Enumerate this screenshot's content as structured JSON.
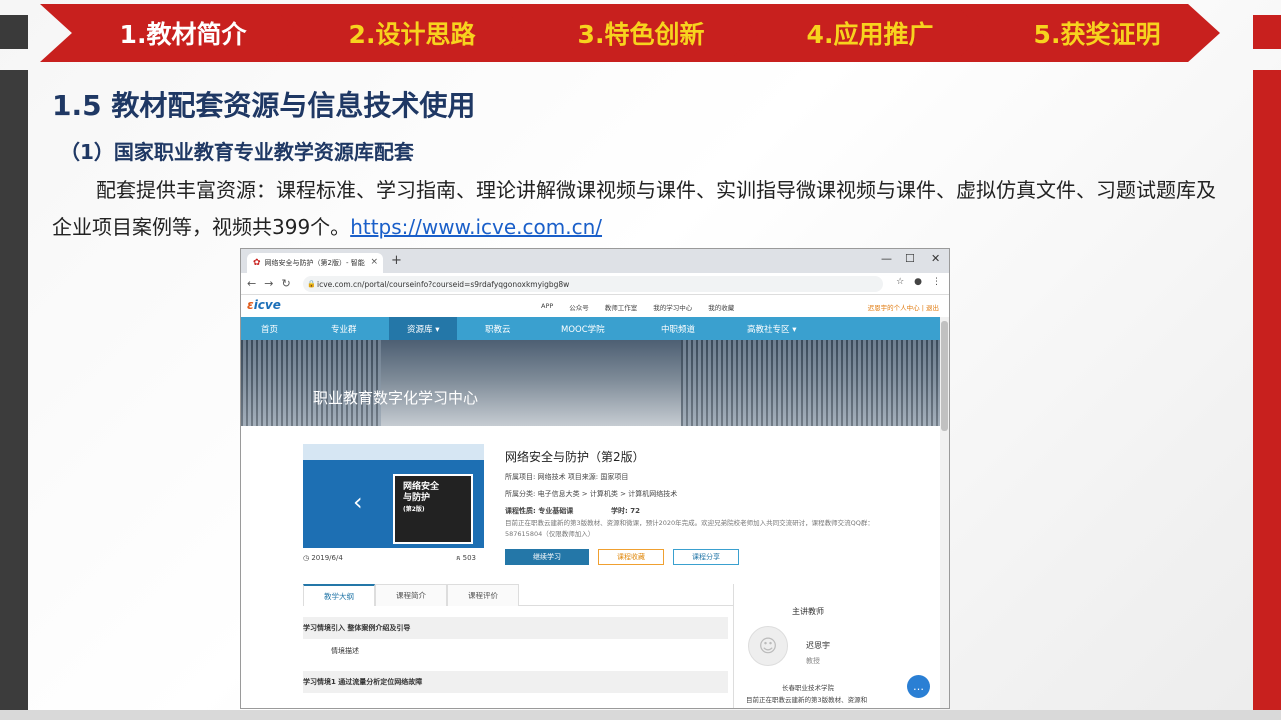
{
  "nav": {
    "items": [
      {
        "label": "1.教材简介",
        "active": true
      },
      {
        "label": "2.设计思路",
        "active": false
      },
      {
        "label": "3.特色创新",
        "active": false
      },
      {
        "label": "4.应用推广",
        "active": false
      },
      {
        "label": "5.获奖证明",
        "active": false
      }
    ]
  },
  "slide": {
    "title": "1.5 教材配套资源与信息技术使用",
    "subtitle": "（1）国家职业教育专业教学资源库配套",
    "body": "配套提供丰富资源：课程标准、学习指南、理论讲解微课视频与课件、实训指导微课视频与课件、虚拟仿真文件、习题试题库及企业项目案例等，视频共399个。",
    "link": "https://www.icve.com.cn/"
  },
  "browser": {
    "tab_title": "网络安全与防护（第2版）- 智能",
    "url": "icve.com.cn/portal/courseinfo?courseid=s9rdafyqgonoxkmyigbg8w",
    "site": {
      "logo": "icve",
      "top_links": [
        "APP",
        "公众号",
        "教师工作室",
        "我的学习中心",
        "我的收藏"
      ],
      "user_links": "迟恩宇的个人中心  |  退出",
      "nav": [
        "首页",
        "专业群",
        "资源库 ▾",
        "职教云",
        "MOOC学院",
        "中职频道",
        "高教社专区 ▾"
      ],
      "banner": "职业教育数字化学习中心"
    },
    "course": {
      "cover_title": "网络安全\n与防护",
      "cover_edition": "(第2版)",
      "date": "2019/6/4",
      "views": "503",
      "name": "网络安全与防护（第2版）",
      "project": "所属项目: 网络技术    项目来源: 国家项目",
      "category": "所属分类: 电子信息大类 > 计算机类 > 计算机网络技术",
      "nature_label": "课程性质: 专业基础课",
      "hours_label": "学时:  72",
      "description": "目前正在职教云建新的第3版教材、资源和微课，预计2020年完成。欢迎兄弟院校老师加入共同交流研讨，课程教师交流QQ群：587615804（仅限教师加入）",
      "buttons": {
        "continue": "继续学习",
        "collect": "课程收藏",
        "share": "课程分享"
      },
      "tabs": [
        "教学大纲",
        "课程简介",
        "课程评价"
      ],
      "outline": [
        {
          "text": "学习情境引入 整体案例介绍及引导",
          "type": "hdr"
        },
        {
          "text": "情境描述",
          "type": "sub"
        },
        {
          "text": "学习情境1 通过流量分析定位网络故障",
          "type": "hdr"
        }
      ],
      "teacher": {
        "heading": "主讲教师",
        "name": "迟恩宇",
        "title": "教授",
        "school": "长春职业技术学院",
        "bio": "目前正在职教云建新的第3版教材、资源和"
      }
    }
  }
}
